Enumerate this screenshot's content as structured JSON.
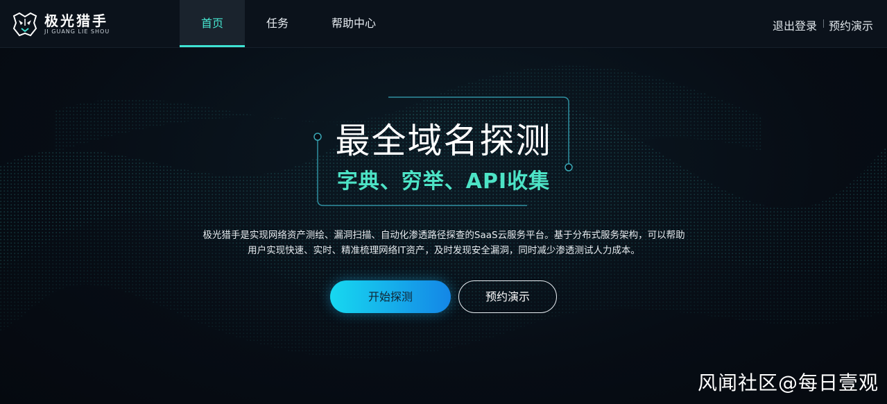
{
  "brand": {
    "name_cn": "极光猎手",
    "name_en": "JI GUANG LIE SHOU",
    "logo_icon": "tiger-head-icon"
  },
  "nav": {
    "tabs": [
      {
        "label": "首页",
        "active": true
      },
      {
        "label": "任务",
        "active": false
      },
      {
        "label": "帮助中心",
        "active": false
      }
    ],
    "right_links": [
      "退出登录",
      "预约演示"
    ]
  },
  "hero": {
    "title": "最全域名探测",
    "subtitle": "字典、穷举、API收集",
    "description_line1": "极光猎手是实现网络资产测绘、漏洞扫描、自动化渗透路径探查的SaaS云服务平台。基于分布式服务架构，可以帮助",
    "description_line2": "用户实现快速、实时、精准梳理网络IT资产，及时发现安全漏洞，同时减少渗透测试人力成本。",
    "primary_button": "开始探测",
    "secondary_button": "预约演示"
  },
  "watermark": "风闻社区@每日壹观",
  "colors": {
    "accent": "#3fe3d3",
    "subtitle": "#4de3c6",
    "nav_bg": "#0b121b",
    "page_bg": "#070d15"
  }
}
